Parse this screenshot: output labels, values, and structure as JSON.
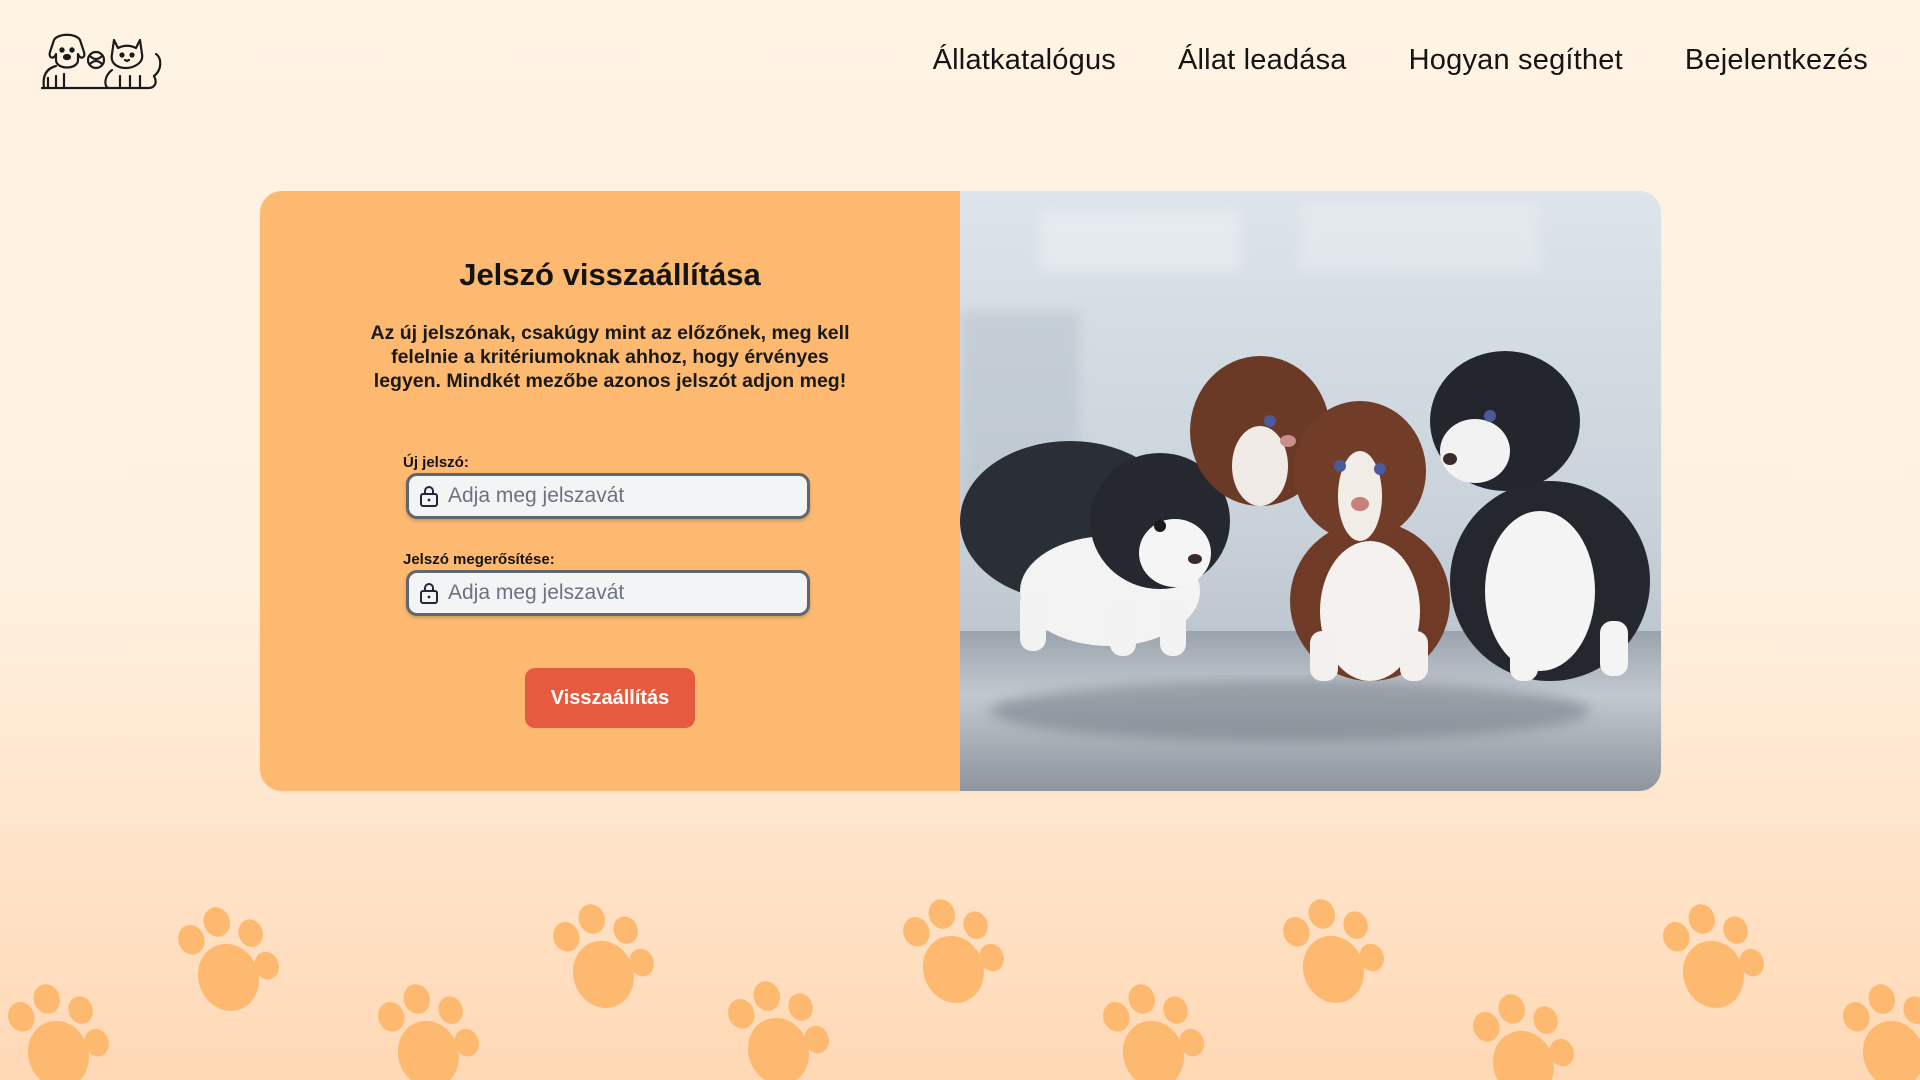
{
  "header": {
    "logo_icon": "dog-and-cat-logo-icon",
    "nav": [
      {
        "label": "Állatkatalógus"
      },
      {
        "label": "Állat leadása"
      },
      {
        "label": "Hogyan segíthet"
      },
      {
        "label": "Bejelentkezés"
      }
    ]
  },
  "form": {
    "title": "Jelszó visszaállítása",
    "description": "Az új jelszónak, csakúgy mint az előzőnek, meg kell felelnie a kritériumoknak ahhoz, hogy érvényes legyen. Mindkét mezőbe azonos jelszót adjon meg!",
    "new_password": {
      "label": "Új jelszó:",
      "placeholder": "Adja meg jelszavát",
      "value": "",
      "icon": "lock-icon"
    },
    "confirm_password": {
      "label": "Jelszó megerősítése:",
      "placeholder": "Adja meg jelszavát",
      "value": "",
      "icon": "lock-icon"
    },
    "submit_label": "Visszaállítás"
  },
  "photo": {
    "subject": "puppies-photo"
  },
  "colors": {
    "page_background": "#fff3e4",
    "form_panel": "#fdb96f",
    "button": "#e65a40",
    "paw_prints": "#fdb96f",
    "input_border": "#5f6670"
  }
}
